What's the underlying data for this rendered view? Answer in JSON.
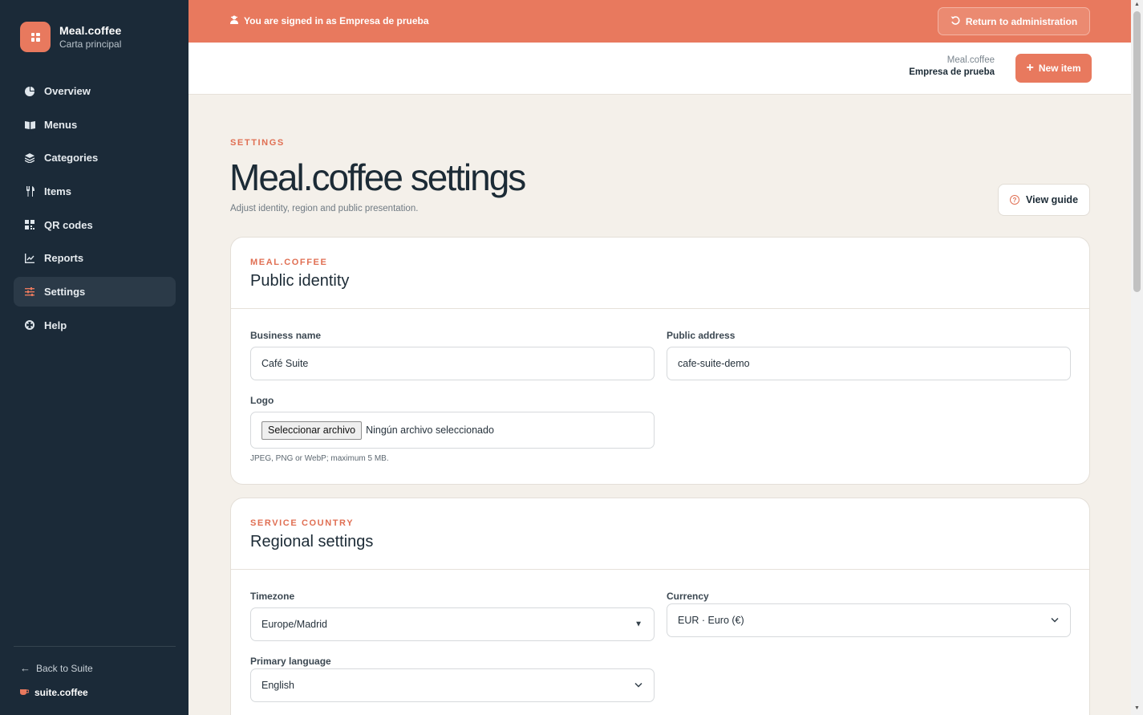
{
  "sidebar": {
    "brand_name": "Meal.coffee",
    "brand_sub": "Carta principal",
    "items": [
      {
        "label": "Overview",
        "icon": "chart-pie-icon"
      },
      {
        "label": "Menus",
        "icon": "book-open-icon"
      },
      {
        "label": "Categories",
        "icon": "layers-icon"
      },
      {
        "label": "Items",
        "icon": "utensils-icon"
      },
      {
        "label": "QR codes",
        "icon": "qr-code-icon"
      },
      {
        "label": "Reports",
        "icon": "chart-line-icon"
      },
      {
        "label": "Settings",
        "icon": "sliders-icon",
        "active": true
      },
      {
        "label": "Help",
        "icon": "lifebuoy-icon"
      }
    ],
    "back_label": "Back to Suite",
    "suite_label": "suite.coffee"
  },
  "banner": {
    "message": "You are signed in as Empresa de prueba",
    "return_label": "Return to administration"
  },
  "topbar": {
    "app_name": "Meal.coffee",
    "company": "Empresa de prueba",
    "new_item_label": "New item"
  },
  "page": {
    "eyebrow": "SETTINGS",
    "title": "Meal.coffee settings",
    "subtitle": "Adjust identity, region and public presentation.",
    "guide_label": "View guide"
  },
  "identity": {
    "eyebrow": "MEAL.COFFEE",
    "title": "Public identity",
    "business_name_label": "Business name",
    "business_name_value": "Café Suite",
    "public_address_label": "Public address",
    "public_address_value": "cafe-suite-demo",
    "logo_label": "Logo",
    "file_button": "Seleccionar archivo",
    "file_status": "Ningún archivo seleccionado",
    "logo_hint": "JPEG, PNG or WebP; maximum 5 MB."
  },
  "regional": {
    "eyebrow": "SERVICE COUNTRY",
    "title": "Regional settings",
    "timezone_label": "Timezone",
    "timezone_value": "Europe/Madrid",
    "currency_label": "Currency",
    "currency_value": "EUR · Euro (€)",
    "language_label": "Primary language",
    "language_value": "English"
  },
  "colors": {
    "accent": "#e8795e",
    "sidebar_bg": "#1b2a38",
    "page_bg": "#f4f0ea"
  }
}
